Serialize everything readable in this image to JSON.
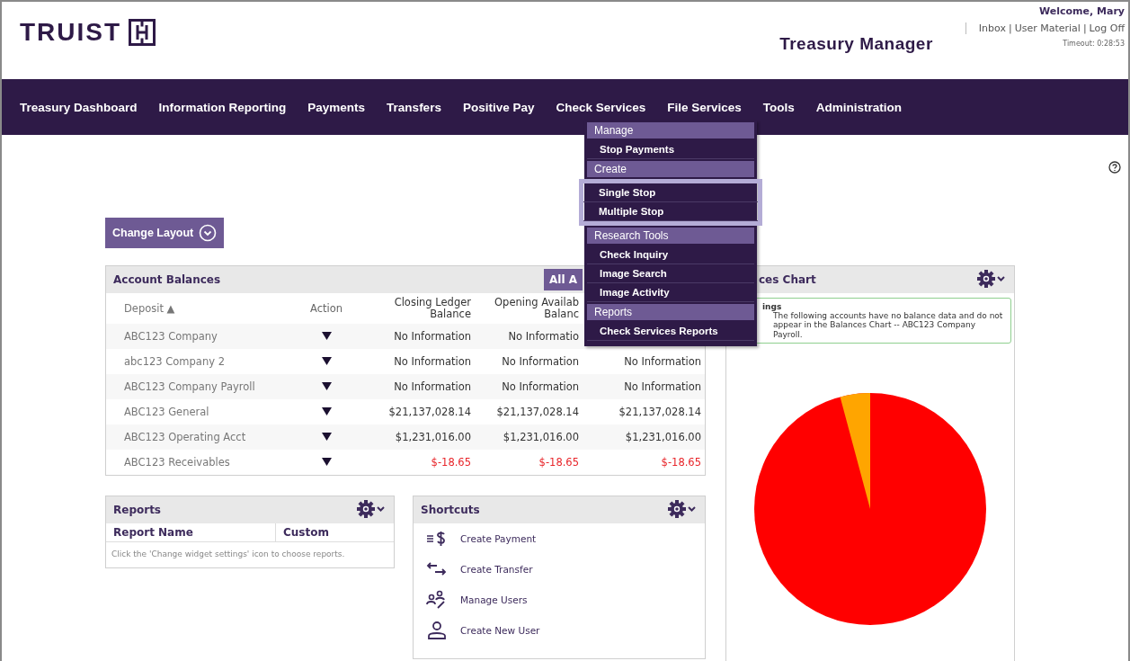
{
  "header": {
    "brand": "TRUIST",
    "product": "Treasury Manager",
    "welcome": "Welcome, Mary",
    "links": [
      "Inbox",
      "User Material",
      "Log Off"
    ],
    "link_separator": "|",
    "timeout": "Timeout: 0:28:53"
  },
  "nav": [
    {
      "label": "Treasury Dashboard"
    },
    {
      "label": "Information Reporting"
    },
    {
      "label": "Payments"
    },
    {
      "label": "Transfers"
    },
    {
      "label": "Positive Pay"
    },
    {
      "label": "Check Services",
      "menu": [
        {
          "heading": "Manage",
          "items": [
            {
              "label": "Stop Payments",
              "highlighted": false
            }
          ]
        },
        {
          "heading": "Create",
          "items": [
            {
              "label": "Single Stop",
              "highlighted": true
            },
            {
              "label": "Multiple Stop",
              "highlighted": true
            }
          ]
        },
        {
          "heading": "Research Tools",
          "items": [
            {
              "label": "Check Inquiry",
              "highlighted": false
            },
            {
              "label": "Image Search",
              "highlighted": false
            },
            {
              "label": "Image Activity",
              "highlighted": false
            }
          ]
        },
        {
          "heading": "Reports",
          "items": [
            {
              "label": "Check Services Reports",
              "highlighted": false
            }
          ]
        }
      ]
    },
    {
      "label": "File Services"
    },
    {
      "label": "Tools"
    },
    {
      "label": "Administration"
    }
  ],
  "change_layout": "Change Layout",
  "account_balances": {
    "title": "Account Balances",
    "filter_button": "All A",
    "columns": [
      "Deposit ▲",
      "Action",
      "Closing Ledger Balance",
      "Opening Availab Balanc"
    ],
    "rows": [
      {
        "deposit": "ABC123 Company",
        "negative": false,
        "values": [
          "No Information",
          "No Informatio"
        ]
      },
      {
        "deposit": "abc123 Company 2",
        "negative": false,
        "values": [
          "No Information",
          "No Information",
          "No Information"
        ]
      },
      {
        "deposit": "ABC123 Company Payroll",
        "negative": false,
        "values": [
          "No Information",
          "No Information",
          "No Information"
        ]
      },
      {
        "deposit": "ABC123 General",
        "negative": false,
        "values": [
          "$21,137,028.14",
          "$21,137,028.14",
          "$21,137,028.14"
        ]
      },
      {
        "deposit": "ABC123 Operating Acct",
        "negative": false,
        "values": [
          "$1,231,016.00",
          "$1,231,016.00",
          "$1,231,016.00"
        ]
      },
      {
        "deposit": "ABC123 Receivables",
        "negative": true,
        "values": [
          "$-18.65",
          "$-18.65",
          "$-18.65"
        ]
      }
    ]
  },
  "reports": {
    "title": "Reports",
    "columns": [
      "Report Name",
      "Custom"
    ],
    "empty_text": "Click the 'Change widget settings' icon to choose reports."
  },
  "shortcuts": {
    "title": "Shortcuts",
    "items": [
      {
        "kind": "payment",
        "label": "Create Payment"
      },
      {
        "kind": "transfer",
        "label": "Create Transfer"
      },
      {
        "kind": "users",
        "label": "Manage Users"
      },
      {
        "kind": "user",
        "label": "Create New User"
      }
    ]
  },
  "balances_chart": {
    "title": "ces Chart",
    "warning_title": "ings",
    "warning_text": "The following accounts have no balance data and do not appear in the Balances Chart -- ABC123 Company Payroll."
  }
}
